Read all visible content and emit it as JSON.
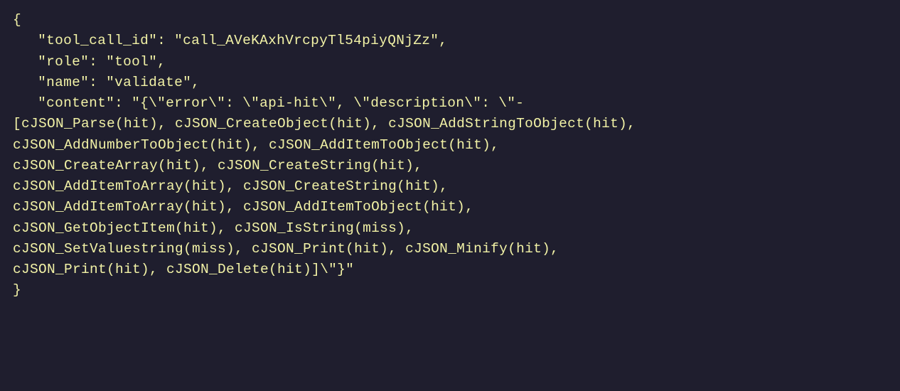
{
  "code": {
    "open_brace": "{",
    "close_brace": "}",
    "keys": {
      "tool_call_id": "\"tool_call_id\"",
      "role": "\"role\"",
      "name": "\"name\"",
      "content": "\"content\""
    },
    "values": {
      "tool_call_id": "\"call_AVeKAxhVrcpyTl54piyQNjZz\"",
      "role": "\"tool\"",
      "name": "\"validate\"",
      "content_line1": "\"{\\\"error\\\": \\\"api-hit\\\", \\\"description\\\": \\\"-",
      "content_line2": "[cJSON_Parse(hit), cJSON_CreateObject(hit), cJSON_AddStringToObject(hit),",
      "content_line3": "cJSON_AddNumberToObject(hit), cJSON_AddItemToObject(hit),",
      "content_line4": "cJSON_CreateArray(hit), cJSON_CreateString(hit),",
      "content_line5": "cJSON_AddItemToArray(hit), cJSON_CreateString(hit),",
      "content_line6": "cJSON_AddItemToArray(hit), cJSON_AddItemToObject(hit),",
      "content_line7": "cJSON_GetObjectItem(hit), cJSON_IsString(miss),",
      "content_line8": "cJSON_SetValuestring(miss), cJSON_Print(hit), cJSON_Minify(hit),",
      "content_line9": "cJSON_Print(hit), cJSON_Delete(hit)]\\\"}\""
    },
    "colon_sep": ": ",
    "comma": ","
  }
}
